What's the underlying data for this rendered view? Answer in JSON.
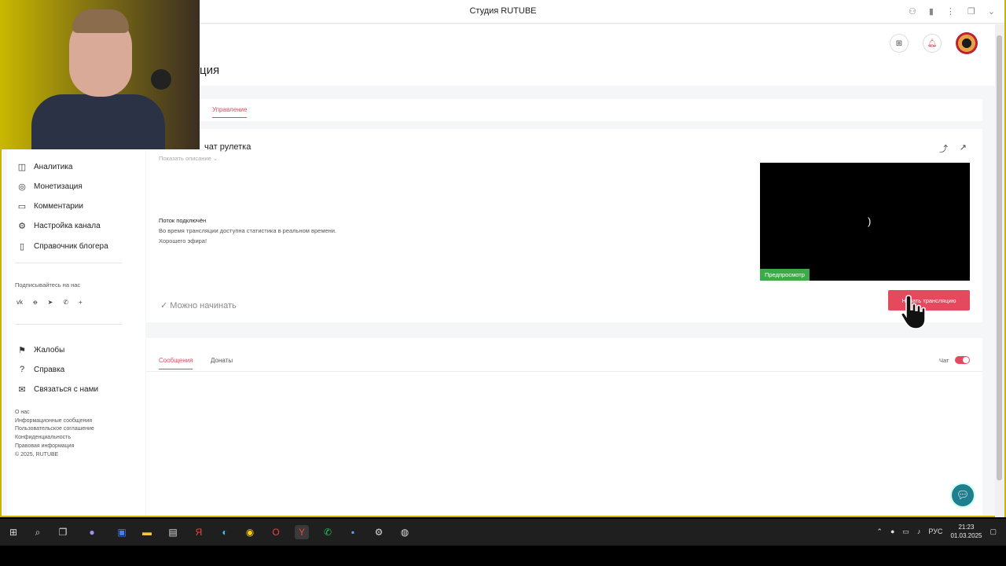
{
  "browser": {
    "tab_title": "Студия RUTUBE"
  },
  "page": {
    "title_fragment": "ция",
    "tab_manage": "Управление"
  },
  "sidebar": {
    "items": [
      {
        "icon": "analytics-icon",
        "label": "Аналитика"
      },
      {
        "icon": "monetization-icon",
        "label": "Монетизация"
      },
      {
        "icon": "comments-icon",
        "label": "Комментарии"
      },
      {
        "icon": "settings-icon",
        "label": "Настройка канала"
      },
      {
        "icon": "book-icon",
        "label": "Справочник блогера"
      }
    ],
    "subscribe_label": "Подписывайтесь на нас",
    "social_icons": [
      "vk-icon",
      "ok-icon",
      "telegram-icon",
      "viber-icon",
      "plus-icon"
    ],
    "bottom_items": [
      {
        "icon": "flag-icon",
        "label": "Жалобы"
      },
      {
        "icon": "help-icon",
        "label": "Справка"
      },
      {
        "icon": "mail-icon",
        "label": "Связаться с нами"
      }
    ],
    "footer_links": [
      "О нас",
      "Информационные сообщения",
      "Пользовательское соглашение",
      "Конфиденциальность",
      "Правовая информация",
      "© 2025, RUTUBE"
    ]
  },
  "stream": {
    "title": "чат рулетка",
    "show_description": "Показать описание",
    "status_title": "Поток подключён",
    "status_line1": "Во время трансляции доступна статистика в реальном времени.",
    "status_line2": "Хорошего эфира!",
    "ready_label": "Можно начинать",
    "preview_badge": "Предпросмотр",
    "start_button": "Начать трансляцию"
  },
  "chat": {
    "tab_messages": "Сообщения",
    "tab_donations": "Донаты",
    "chat_toggle_label": "Чат",
    "chat_enabled": true
  },
  "taskbar": {
    "lang": "РУС",
    "time": "21:23",
    "date": "01.03.2025"
  },
  "colors": {
    "accent": "#e5495d",
    "preview_badge": "#3daa4a"
  }
}
